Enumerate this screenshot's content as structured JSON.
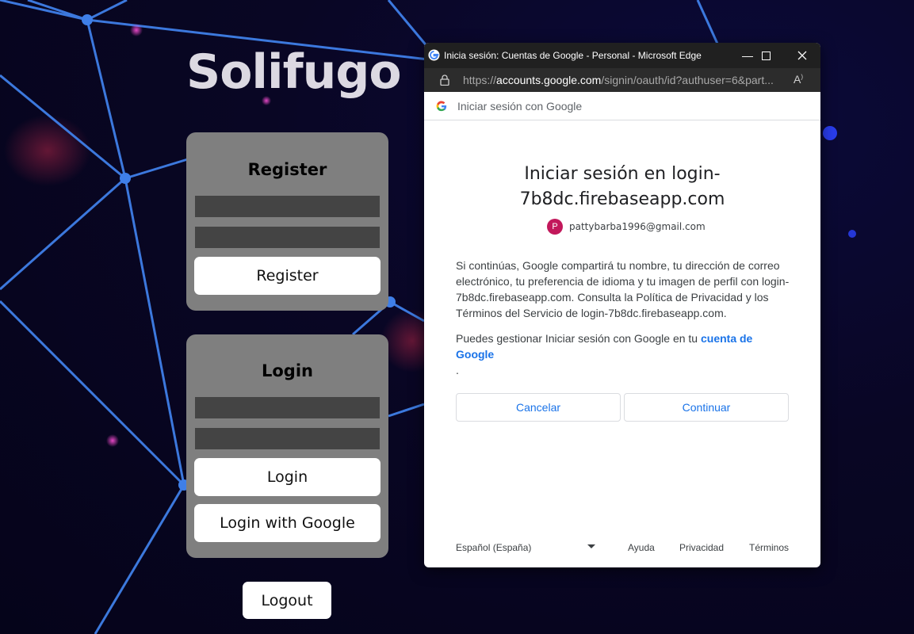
{
  "app": {
    "title": "Solifugo",
    "register": {
      "heading": "Register",
      "button": "Register"
    },
    "login": {
      "heading": "Login",
      "button": "Login",
      "google_button": "Login with Google"
    },
    "logout": "Logout"
  },
  "popup": {
    "window_title": "Inicia sesión: Cuentas de Google - Personal - Microsoft Edge",
    "url_prefix": "https://",
    "url_host": "accounts.google.com",
    "url_path": "/signin/oauth/id?authuser=6&part...",
    "header_text": "Iniciar sesión con Google",
    "heading_line1": "Iniciar sesión en login-",
    "heading_line2": "7b8dc.firebaseapp.com",
    "avatar_letter": "P",
    "email": "pattybarba1996@gmail.com",
    "consent_text": "Si continúas, Google compartirá tu nombre, tu dirección de correo electrónico, tu preferencia de idioma y tu imagen de perfil con login-7b8dc.firebaseapp.com. Consulta la Política de Privacidad y los Términos del Servicio de login-7b8dc.firebaseapp.com.",
    "manage_text": "Puedes gestionar Iniciar sesión con Google en tu ",
    "manage_link": "cuenta de Google",
    "manage_end": ".",
    "cancel_label": "Cancelar",
    "continue_label": "Continuar",
    "language": "Español (España)",
    "help": "Ayuda",
    "privacy": "Privacidad",
    "terms": "Términos"
  },
  "colors": {
    "accent": "#1a73e8",
    "card": "#7f7f7f",
    "field": "#444444",
    "network_line": "#3f7fe8"
  }
}
